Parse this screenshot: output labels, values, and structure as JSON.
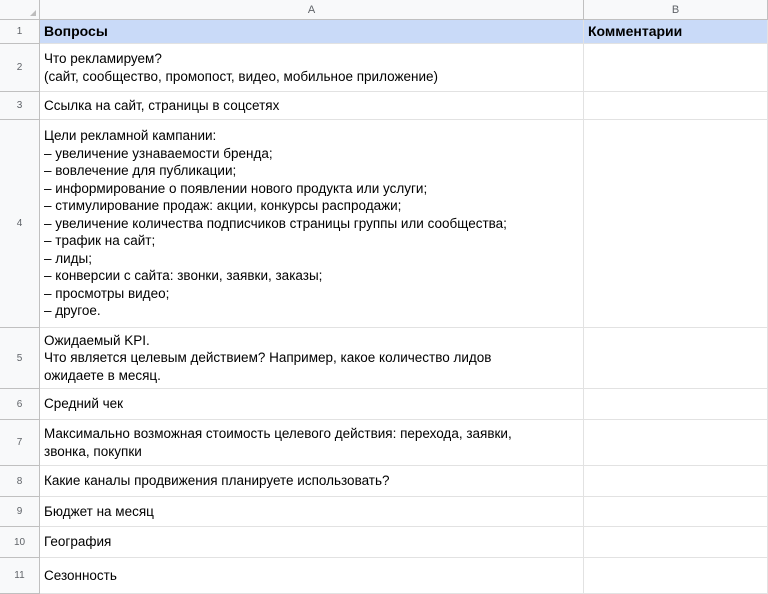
{
  "columns": [
    "A",
    "B"
  ],
  "header": {
    "row": "1",
    "a": "Вопросы",
    "b": "Комментарии"
  },
  "rows": [
    {
      "row": "2",
      "lines": [
        "Что рекламируем?",
        "(сайт, сообщество, промопост, видео, мобильное приложение)"
      ]
    },
    {
      "row": "3",
      "lines": [
        "Ссылка на сайт, страницы в соцсетях"
      ]
    },
    {
      "row": "4",
      "lines": [
        "Цели рекламной кампании:",
        "– увеличение узнаваемости бренда;",
        "– вовлечение для публикации;",
        "– информирование о появлении нового продукта или услуги;",
        "– стимулирование продаж: акции, конкурсы распродажи;",
        "– увеличение количества подписчиков страницы группы или сообщества;",
        "– трафик на сайт;",
        "– лиды;",
        "– конверсии с сайта: звонки, заявки, заказы;",
        "– просмотры видео;",
        "– другое."
      ]
    },
    {
      "row": "5",
      "lines": [
        "Ожидаемый KPI.",
        "Что является целевым действием? Например, какое количество лидов",
        "ожидаете в месяц."
      ]
    },
    {
      "row": "6",
      "lines": [
        "Средний чек"
      ]
    },
    {
      "row": "7",
      "lines": [
        "Максимально возможная стоимость целевого действия: перехода, заявки,",
        "звонка, покупки"
      ]
    },
    {
      "row": "8",
      "lines": [
        "Какие каналы продвижения планируете использовать?"
      ]
    },
    {
      "row": "9",
      "lines": [
        "Бюджет на месяц"
      ]
    },
    {
      "row": "10",
      "lines": [
        "География"
      ]
    },
    {
      "row": "11",
      "lines": [
        "Сезонность"
      ]
    }
  ]
}
